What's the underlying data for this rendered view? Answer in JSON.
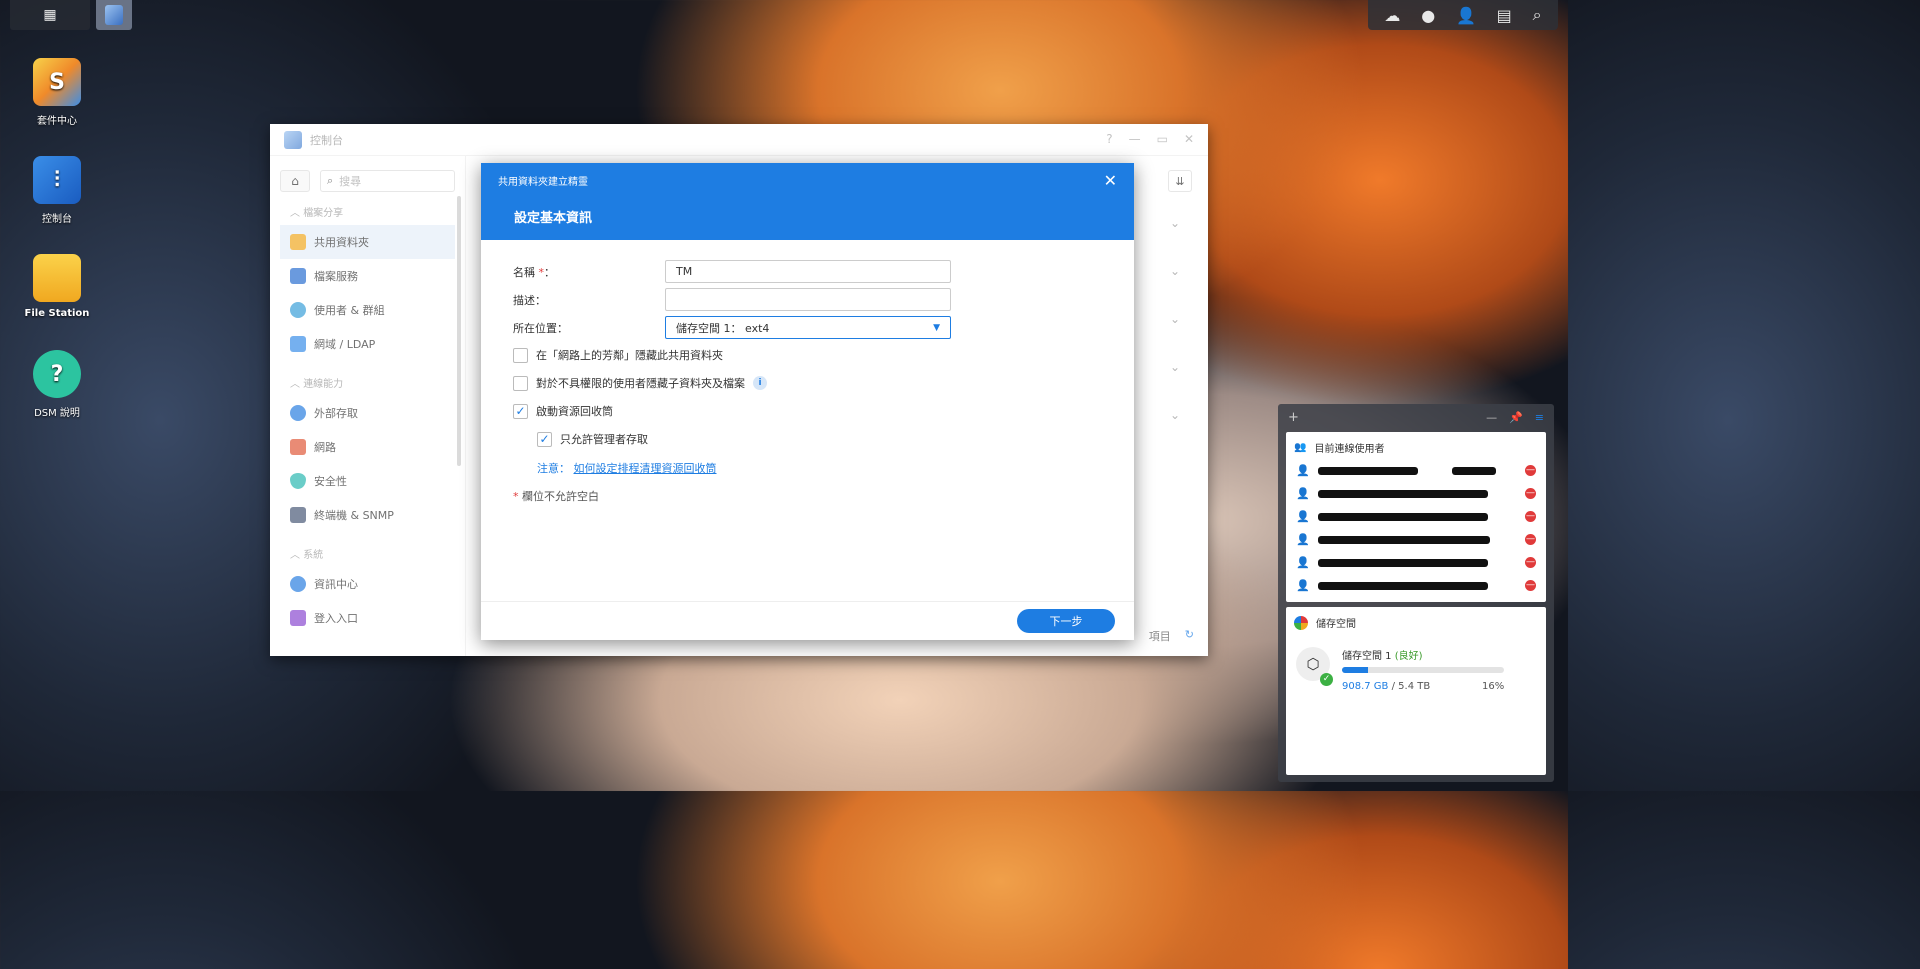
{
  "desktop": {
    "icons": [
      {
        "label": "套件中心"
      },
      {
        "label": "控制台"
      },
      {
        "label": "File Station"
      },
      {
        "label": "DSM 說明"
      }
    ]
  },
  "window": {
    "title": "控制台",
    "search_placeholder": "搜尋",
    "sections": [
      {
        "label": "檔案分享",
        "items": [
          "共用資料夾",
          "檔案服務",
          "使用者 & 群組",
          "網域 / LDAP"
        ]
      },
      {
        "label": "連線能力",
        "items": [
          "外部存取",
          "網路",
          "安全性",
          "終端機 & SNMP"
        ]
      },
      {
        "label": "系統",
        "items": [
          "資訊中心",
          "登入入口"
        ]
      }
    ],
    "bottom_label": "項目"
  },
  "wizard": {
    "title": "共用資料夾建立精靈",
    "step_title": "設定基本資訊",
    "name_label": "名稱",
    "name_colon": "：",
    "req_star": "*",
    "name_value": "TM",
    "desc_label": "描述：",
    "desc_value": "",
    "location_label": "所在位置：",
    "location_value": "儲存空間 1： ext4",
    "checkbox_hide_network": "在「網路上的芳鄰」隱藏此共用資料夾",
    "checkbox_hide_subfolders": "對於不具權限的使用者隱藏子資料夾及檔案",
    "checkbox_recycle_bin": "啟動資源回收筒",
    "checkbox_admin_only": "只允許管理者存取",
    "note_prefix": "注意：",
    "note_link": "如何設定排程清理資源回收筒",
    "required_note": "欄位不允許空白",
    "next_button": "下一步",
    "checked": {
      "hide_network": false,
      "hide_subfolders": false,
      "recycle_bin": true,
      "admin_only": true
    }
  },
  "widgets": {
    "users_title": "目前連線使用者",
    "user_count": 6,
    "storage_title": "儲存空間",
    "volume_name": "儲存空間 1",
    "volume_status": "(良好)",
    "used": "908.7 GB",
    "total": "/ 5.4 TB",
    "percent": "16%",
    "percent_value": 16
  },
  "colors": {
    "accent": "#1e7de2",
    "danger": "#e03a3a",
    "ok": "#3cb043"
  }
}
